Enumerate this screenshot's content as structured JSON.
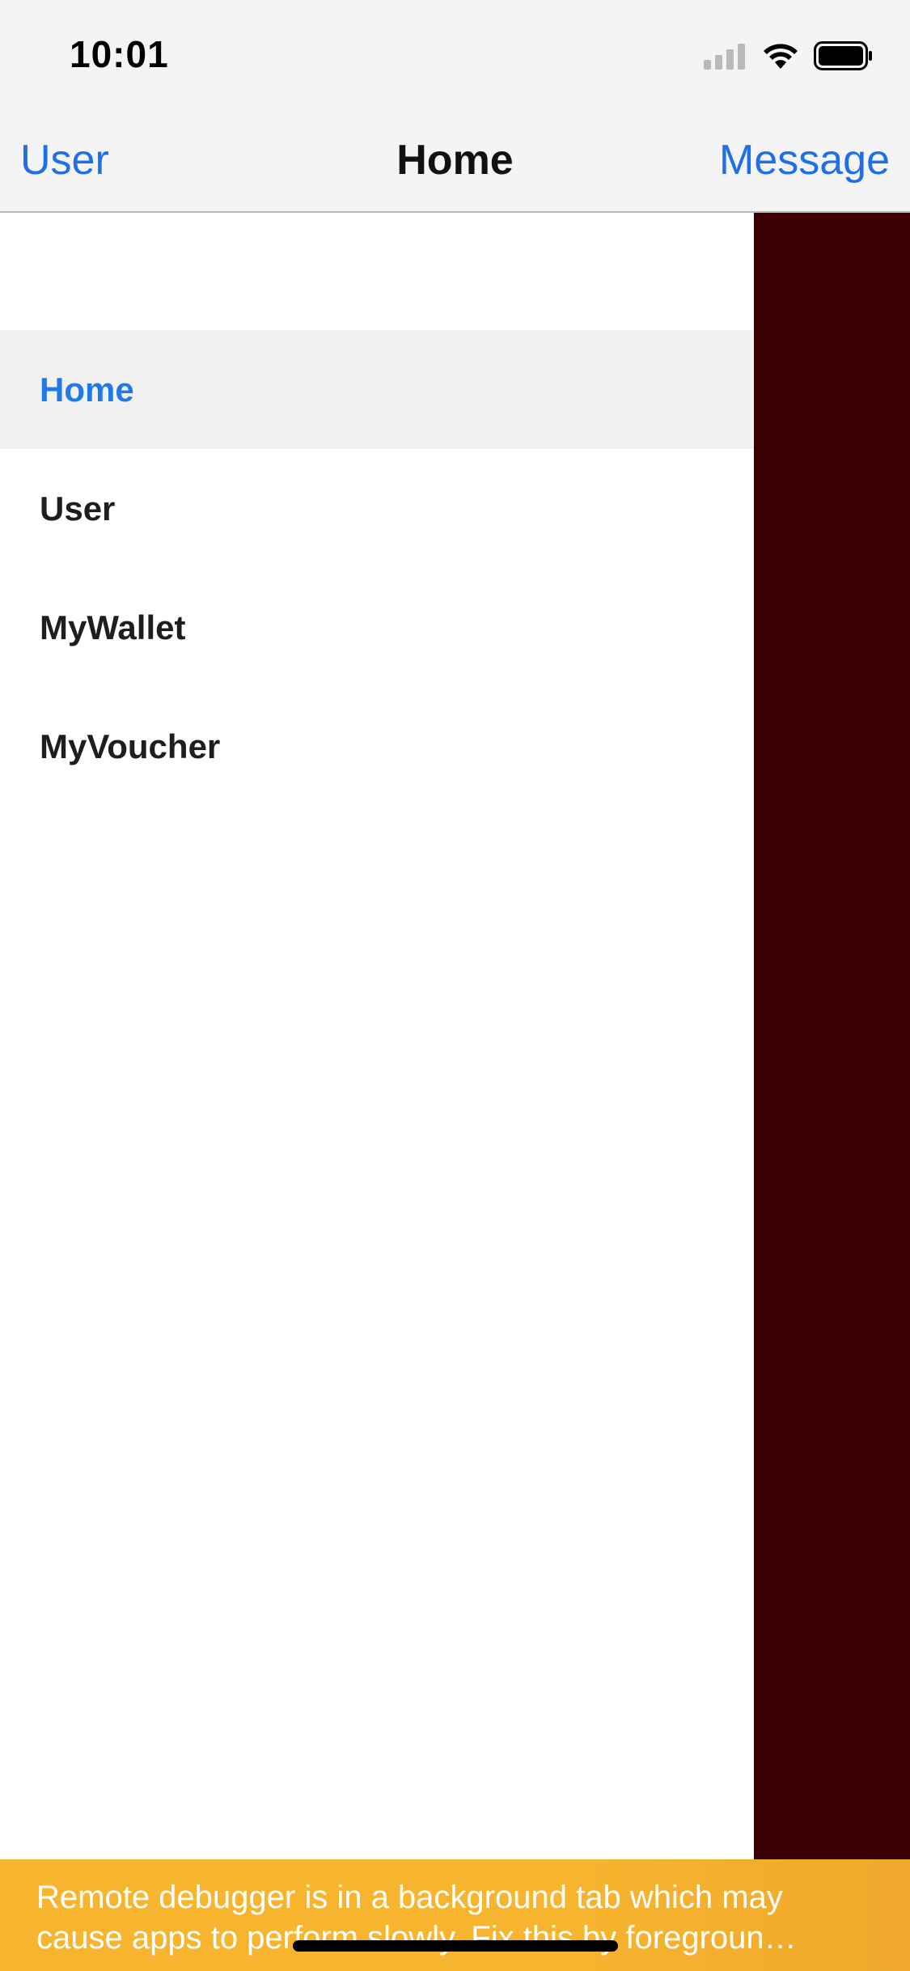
{
  "status_bar": {
    "time": "10:01",
    "icons": [
      "cellular-signal-icon",
      "wifi-icon",
      "battery-icon"
    ]
  },
  "nav_bar": {
    "left_label": "User",
    "title": "Home",
    "right_label": "Message",
    "accent_color": "#1f6fea"
  },
  "drawer": {
    "items": [
      {
        "label": "Home",
        "active": true
      },
      {
        "label": "User",
        "active": false
      },
      {
        "label": "MyWallet",
        "active": false
      },
      {
        "label": "MyVoucher",
        "active": false
      }
    ],
    "active_color": "#1f7ae7"
  },
  "overlay": {
    "color": "#3b0002"
  },
  "debug_banner": {
    "text": "Remote debugger is in a background tab which may\ncause apps to perform slowly. Fix this by foregroun…",
    "color": "#f7b52f"
  }
}
